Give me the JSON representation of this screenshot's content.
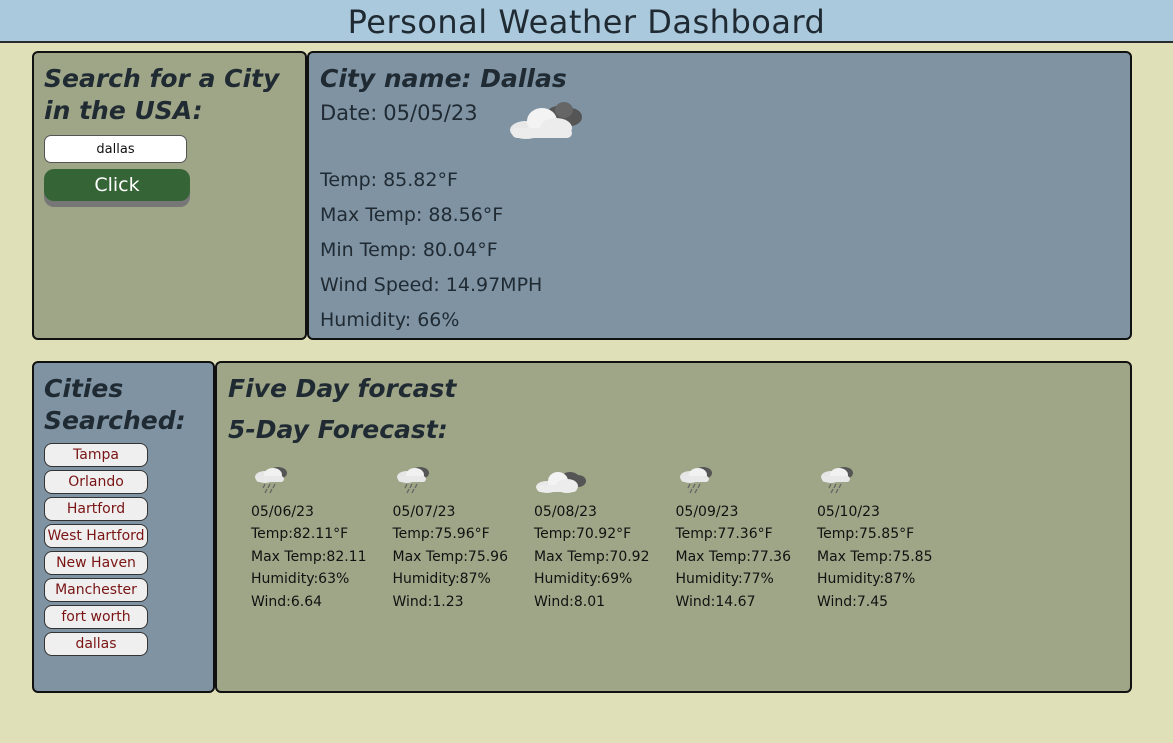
{
  "header": {
    "title": "Personal Weather Dashboard"
  },
  "search": {
    "title": "Search for a City in the USA:",
    "input_value": "dallas",
    "button_label": "Click"
  },
  "current": {
    "city_label": "City name: Dallas",
    "date_label": "Date:",
    "date_value": "05/05/23",
    "icon": "broken-clouds-icon",
    "temp": "Temp: 85.82°F",
    "max_temp": "Max Temp: 88.56°F",
    "min_temp": "Min Temp: 80.04°F",
    "wind": "Wind Speed: 14.97MPH",
    "humidity": "Humidity: 66%"
  },
  "history": {
    "title": "Cities Searched:",
    "cities": [
      "Tampa",
      "Orlando",
      "Hartford",
      "West Hartford",
      "New Haven",
      "Manchester",
      "fort worth",
      "dallas"
    ]
  },
  "forecast": {
    "title": "Five Day forcast",
    "subtitle": "5-Day Forecast:",
    "days": [
      {
        "icon": "rain-cloud-icon",
        "date": "05/06/23",
        "temp": "Temp:82.11°F",
        "max": "Max Temp:82.11",
        "humidity": "Humidity:63%",
        "wind": "Wind:6.64"
      },
      {
        "icon": "rain-cloud-icon",
        "date": "05/07/23",
        "temp": "Temp:75.96°F",
        "max": "Max Temp:75.96",
        "humidity": "Humidity:87%",
        "wind": "Wind:1.23"
      },
      {
        "icon": "broken-clouds-icon",
        "date": "05/08/23",
        "temp": "Temp:70.92°F",
        "max": "Max Temp:70.92",
        "humidity": "Humidity:69%",
        "wind": "Wind:8.01"
      },
      {
        "icon": "rain-cloud-icon",
        "date": "05/09/23",
        "temp": "Temp:77.36°F",
        "max": "Max Temp:77.36",
        "humidity": "Humidity:77%",
        "wind": "Wind:14.67"
      },
      {
        "icon": "rain-cloud-icon",
        "date": "05/10/23",
        "temp": "Temp:75.85°F",
        "max": "Max Temp:75.85",
        "humidity": "Humidity:87%",
        "wind": "Wind:7.45"
      }
    ]
  },
  "colors": {
    "page_bg": "#dfdfb8",
    "header_bg": "#abc9dc",
    "olive_panel": "#9fa687",
    "slate_panel": "#7f93a3",
    "button_green": "#356436",
    "city_text": "#7a1414"
  }
}
